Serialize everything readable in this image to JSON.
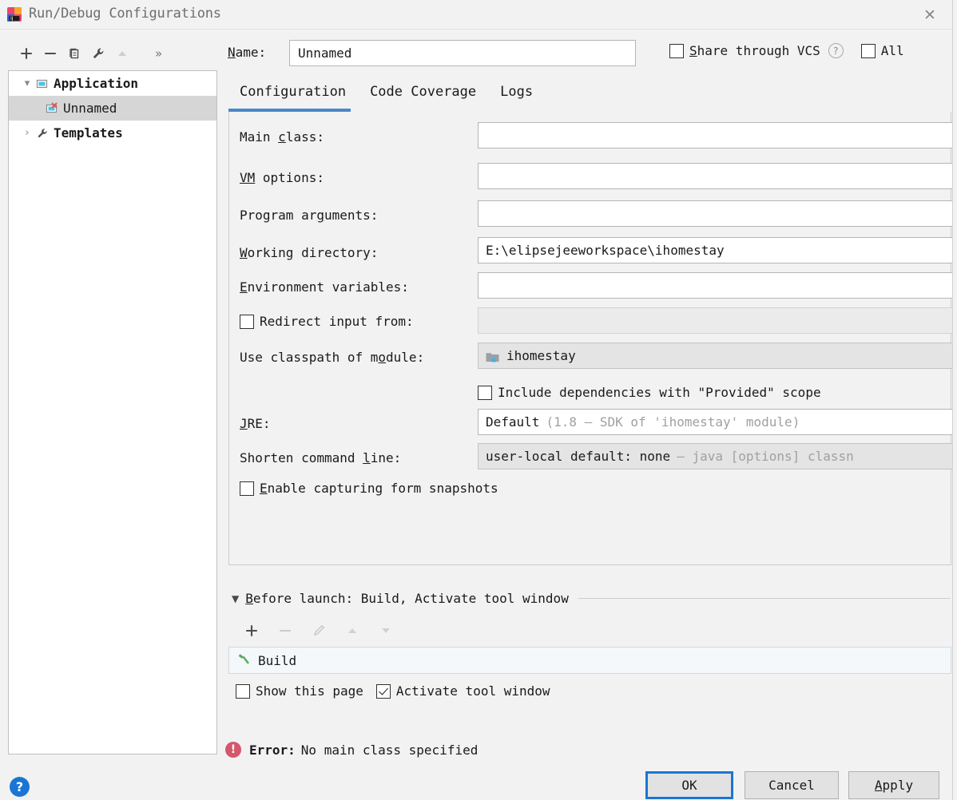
{
  "window": {
    "title": "Run/Debug Configurations",
    "logo_icon": "intellij-idea-logo",
    "close_icon": "close-icon"
  },
  "left_toolbar": {
    "icons": [
      {
        "name": "add-configuration-button",
        "glyph": "+",
        "disabled": false
      },
      {
        "name": "remove-configuration-button",
        "glyph": "−",
        "disabled": false
      },
      {
        "name": "copy-configuration-button",
        "glyph": "copy-icon",
        "disabled": false
      },
      {
        "name": "edit-templates-button",
        "glyph": "wrench-icon",
        "disabled": false
      },
      {
        "name": "move-up-button",
        "glyph": "triangle-up-icon",
        "disabled": true
      }
    ],
    "more_label": "»"
  },
  "name_row": {
    "label": "Name:",
    "label_mnemonic": "N",
    "label_rest": "ame:",
    "value": "Unnamed",
    "placeholder": "Unnamed"
  },
  "options": {
    "share_mnemonic": "S",
    "share_rest": "hare through VCS",
    "share_checked": false,
    "help_glyph": "?",
    "all_label": "All",
    "all_checked": false
  },
  "tree": {
    "items": [
      {
        "label": "Application",
        "icon": "application-icon",
        "twisty": "⌄",
        "bold": true,
        "selected": false,
        "child": false
      },
      {
        "label": "Unnamed",
        "icon": "application-error-icon",
        "twisty": "",
        "bold": false,
        "selected": true,
        "child": true
      },
      {
        "label": "Templates",
        "icon": "wrench-icon",
        "twisty": "›",
        "bold": true,
        "selected": false,
        "child": false
      }
    ]
  },
  "tabs": [
    {
      "label": "Configuration",
      "active": true
    },
    {
      "label": "Code Coverage",
      "active": false
    },
    {
      "label": "Logs",
      "active": false
    }
  ],
  "form": {
    "main_class": {
      "label_pre": "Main ",
      "label_mn": "c",
      "label_post": "lass:",
      "value": ""
    },
    "vm_options": {
      "label_mn": "VM",
      "label_post": " options:",
      "value": ""
    },
    "program_arguments": {
      "label_pre": "Program ar",
      "label_mn": "g",
      "label_post": "uments:",
      "value": ""
    },
    "working_directory": {
      "label_mn": "W",
      "label_post": "orking directory:",
      "value": "E:\\elipsejeeworkspace\\ihomestay"
    },
    "environment_variables": {
      "label_mn": "E",
      "label_post": "nvironment variables:",
      "value": ""
    },
    "redirect_input": {
      "label": "Redirect input from:",
      "checked": false,
      "value": "",
      "disabled": true
    },
    "use_classpath": {
      "label_pre": "Use classpath of m",
      "label_mn": "o",
      "label_post": "dule:",
      "value": "ihomestay",
      "icon": "module-folder-icon"
    },
    "include_provided": {
      "label": "Include dependencies with \"Provided\" scope",
      "checked": false
    },
    "jre": {
      "label_mn": "J",
      "label_post": "RE:",
      "value": "Default",
      "value_muted": "(1.8 – SDK of 'ihomestay' module)"
    },
    "shorten_command_line": {
      "label_pre": "Shorten command ",
      "label_mn": "l",
      "label_post": "ine:",
      "value": "user-local default: none",
      "value_muted": "– java [options] classn"
    },
    "enable_capturing": {
      "label_mn": "E",
      "label_post": "nable capturing form snapshots",
      "checked": false
    }
  },
  "before_launch": {
    "title_mn": "B",
    "title_rest": "efore launch: Build, Activate tool window",
    "toolbar": [
      {
        "name": "add-task-button",
        "glyph": "+",
        "disabled": false
      },
      {
        "name": "remove-task-button",
        "glyph": "−",
        "disabled": true
      },
      {
        "name": "edit-task-button",
        "glyph": "pencil-icon",
        "disabled": true
      },
      {
        "name": "move-task-up-button",
        "glyph": "triangle-up-icon",
        "disabled": true
      },
      {
        "name": "move-task-down-button",
        "glyph": "triangle-down-icon",
        "disabled": true
      }
    ],
    "tasks": [
      {
        "label": "Build",
        "icon": "hammer-icon"
      }
    ],
    "show_page": {
      "label": "Show this page",
      "checked": false
    },
    "activate_tool_window": {
      "label": "Activate tool window",
      "checked": true
    }
  },
  "error": {
    "icon": "error-icon",
    "prefix": "Error:",
    "message": "No main class specified"
  },
  "bottom": {
    "help_glyph": "?",
    "ok_label": "OK",
    "cancel_label": "Cancel",
    "apply_mn": "A",
    "apply_rest": "pply"
  },
  "colors": {
    "accent_blue": "#4a88c7",
    "focus_blue": "#1a76d2",
    "error_red": "#d4576b",
    "selection_grey": "#d6d6d6",
    "build_green": "#5aab5f",
    "dialog_bg": "#f2f2f2"
  }
}
